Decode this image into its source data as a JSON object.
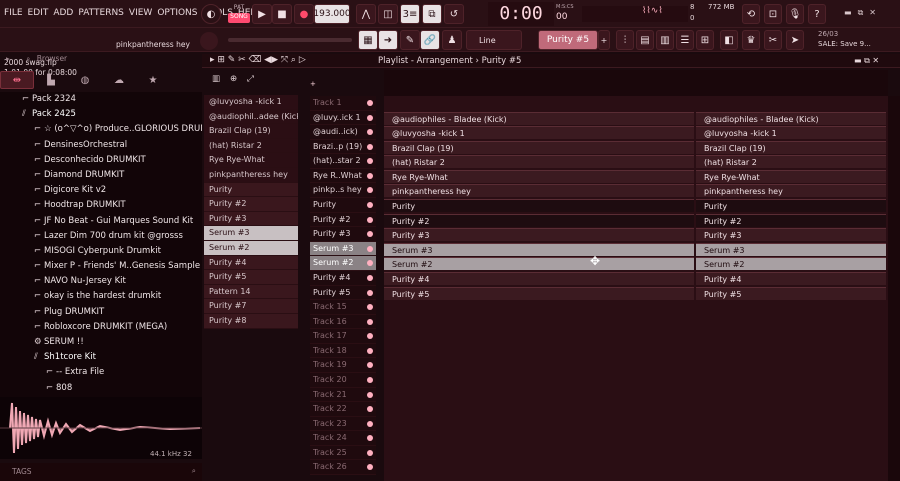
{
  "menu": [
    "FILE",
    "EDIT",
    "ADD",
    "PATTERNS",
    "VIEW",
    "OPTIONS",
    "TOOLS",
    "HELP"
  ],
  "transport": {
    "tempo": "193.000",
    "time": "0:00",
    "time_small": "00",
    "msc_label": "M:S:CS",
    "memory": "772 MB",
    "cpu": "8",
    "voices": "0",
    "pattern": "Purity #5",
    "snap": "Line",
    "pat_label": "PAT",
    "song_label": "SONG"
  },
  "hint": {
    "line1": "2000 swag.flp",
    "line2": "1:01:00 for 0:08:00",
    "active": "pinkpantheress hey"
  },
  "news": {
    "date": "26/03",
    "text": "SALE: Save 9..."
  },
  "browser": {
    "title": "Browser",
    "items": [
      {
        "label": "Pack 2324",
        "indent": 1,
        "icon": "folder"
      },
      {
        "label": "Pack 2425",
        "indent": 1,
        "icon": "folder-open"
      },
      {
        "label": "☆ (o^▽^o) Produce..GLORIOUS DRUMKIT",
        "indent": 2,
        "icon": "folder"
      },
      {
        "label": "DensinesOrchestral",
        "indent": 2,
        "icon": "folder"
      },
      {
        "label": "Desconhecido DRUMKIT",
        "indent": 2,
        "icon": "folder"
      },
      {
        "label": "Diamond DRUMKIT",
        "indent": 2,
        "icon": "folder"
      },
      {
        "label": "Digicore Kit v2",
        "indent": 2,
        "icon": "folder"
      },
      {
        "label": "Hoodtrap DRUMKIT",
        "indent": 2,
        "icon": "folder"
      },
      {
        "label": "JF No Beat - Gui Marques Sound Kit",
        "indent": 2,
        "icon": "folder"
      },
      {
        "label": "Lazer Dim 700 drum kit @grosss",
        "indent": 2,
        "icon": "folder"
      },
      {
        "label": "MISOGI Cyberpunk Drumkit",
        "indent": 2,
        "icon": "folder"
      },
      {
        "label": "Mixer P - Friends' M..Genesis Sample Pack",
        "indent": 2,
        "icon": "folder"
      },
      {
        "label": "NAVO Nu-Jersey Kit",
        "indent": 2,
        "icon": "folder"
      },
      {
        "label": "okay is the hardest drumkit",
        "indent": 2,
        "icon": "folder"
      },
      {
        "label": "Plug DRUMKIT",
        "indent": 2,
        "icon": "folder"
      },
      {
        "label": "Robloxcore DRUMKIT (MEGA)",
        "indent": 2,
        "icon": "folder"
      },
      {
        "label": "SERUM !!",
        "indent": 2,
        "icon": "gear"
      },
      {
        "label": "Sh1tcore Kit",
        "indent": 2,
        "icon": "folder-open"
      },
      {
        "label": "-- Extra File",
        "indent": 3,
        "icon": "folder"
      },
      {
        "label": "808",
        "indent": 3,
        "icon": "folder"
      }
    ],
    "sample_rate": "44.1 kHz 32",
    "tags_label": "TAGS"
  },
  "playlist": {
    "title": "Playlist - Arrangement › Purity #5"
  },
  "channels": [
    {
      "label": "@luvyosha -kick 1",
      "state": "normal"
    },
    {
      "label": "@audiophil..adee (Kick)",
      "state": "normal"
    },
    {
      "label": "Brazil Clap (19)",
      "state": "normal"
    },
    {
      "label": "(hat) Ristar 2",
      "state": "normal"
    },
    {
      "label": "Rye Rye-What",
      "state": "normal"
    },
    {
      "label": "pinkpantheress hey",
      "state": "normal"
    },
    {
      "label": "Purity",
      "state": "dim"
    },
    {
      "label": "Purity #2",
      "state": "dim"
    },
    {
      "label": "Purity #3",
      "state": "dim"
    },
    {
      "label": "Serum #3",
      "state": "sel"
    },
    {
      "label": "Serum #2",
      "state": "sel"
    },
    {
      "label": "Purity #4",
      "state": "dim"
    },
    {
      "label": "Purity #5",
      "state": "dim"
    },
    {
      "label": "Pattern 14",
      "state": "dim"
    },
    {
      "label": "Purity #7",
      "state": "dim"
    },
    {
      "label": "Purity #8",
      "state": "dim"
    }
  ],
  "tracks": [
    "Track 1",
    "@luvy..ick 1",
    "@audi..ick)",
    "Brazi..p (19)",
    "(hat)..star 2",
    "Rye R..What",
    "pinkp..s hey",
    "Purity",
    "Purity #2",
    "Purity #3",
    "Serum #3",
    "Serum #2",
    "Purity #4",
    "Purity #5",
    "Track 15",
    "Track 16",
    "Track 17",
    "Track 18",
    "Track 19",
    "Track 20",
    "Track 21",
    "Track 22",
    "Track 23",
    "Track 24",
    "Track 25",
    "Track 26"
  ],
  "clips_left": [
    "@audiophiles - Bladee (Kick)",
    "@luvyosha -kick 1",
    "Brazil Clap (19)",
    "(hat) Ristar 2",
    "Rye Rye-What",
    "pinkpantheress hey",
    "Purity",
    "Purity #2",
    "Purity #3",
    "Serum #3",
    "Serum #2",
    "Purity #4",
    "Purity #5"
  ],
  "clips_right": [
    "@audiophiles - Bladee (Kick)",
    "@luvyosha -kick 1",
    "Brazil Clap (19)",
    "(hat) Ristar 2",
    "Rye Rye-What",
    "pinkpantheress hey",
    "Purity",
    "Purity #2",
    "Purity #3",
    "Serum #3",
    "Serum #2",
    "Purity #4",
    "Purity #5"
  ],
  "colors": {
    "accent": "#ff7090",
    "bg": "#1a0a0e"
  }
}
